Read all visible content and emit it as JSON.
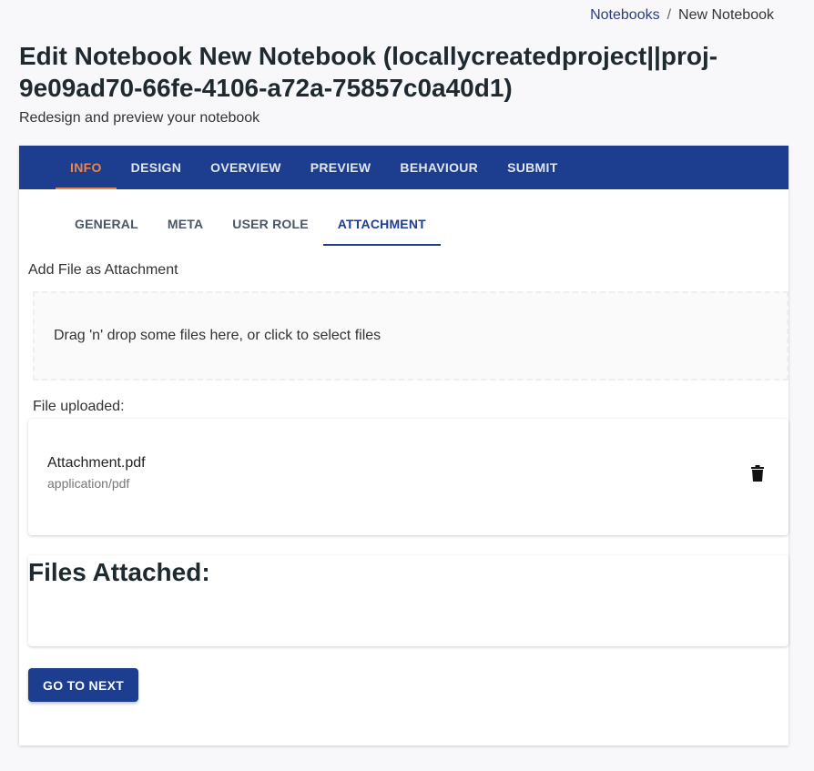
{
  "breadcrumb": {
    "parent": "Notebooks",
    "separator": "/",
    "current": "New Notebook"
  },
  "page": {
    "title": "Edit Notebook New Notebook (locallycreatedproject||proj-9e09ad70-66fe-4106-a72a-75857c0a40d1)",
    "subtitle": "Redesign and preview your notebook"
  },
  "main_tabs": [
    {
      "label": "INFO",
      "active": true
    },
    {
      "label": "DESIGN",
      "active": false
    },
    {
      "label": "OVERVIEW",
      "active": false
    },
    {
      "label": "PREVIEW",
      "active": false
    },
    {
      "label": "BEHAVIOUR",
      "active": false
    },
    {
      "label": "SUBMIT",
      "active": false
    }
  ],
  "sub_tabs": [
    {
      "label": "GENERAL",
      "active": false
    },
    {
      "label": "META",
      "active": false
    },
    {
      "label": "USER ROLE",
      "active": false
    },
    {
      "label": "ATTACHMENT",
      "active": true
    }
  ],
  "attachment": {
    "section_label": "Add File as Attachment",
    "dropzone_text": "Drag 'n' drop some files here, or click to select files",
    "uploaded_label": "File uploaded:",
    "file": {
      "name": "Attachment.pdf",
      "type": "application/pdf",
      "delete_icon": "trash-icon"
    },
    "attached_title": "Files Attached:"
  },
  "actions": {
    "next_label": "GO TO NEXT"
  },
  "colors": {
    "primary": "#1d3d8f",
    "active_tab": "#e8874a",
    "background": "#f8f8fa"
  }
}
